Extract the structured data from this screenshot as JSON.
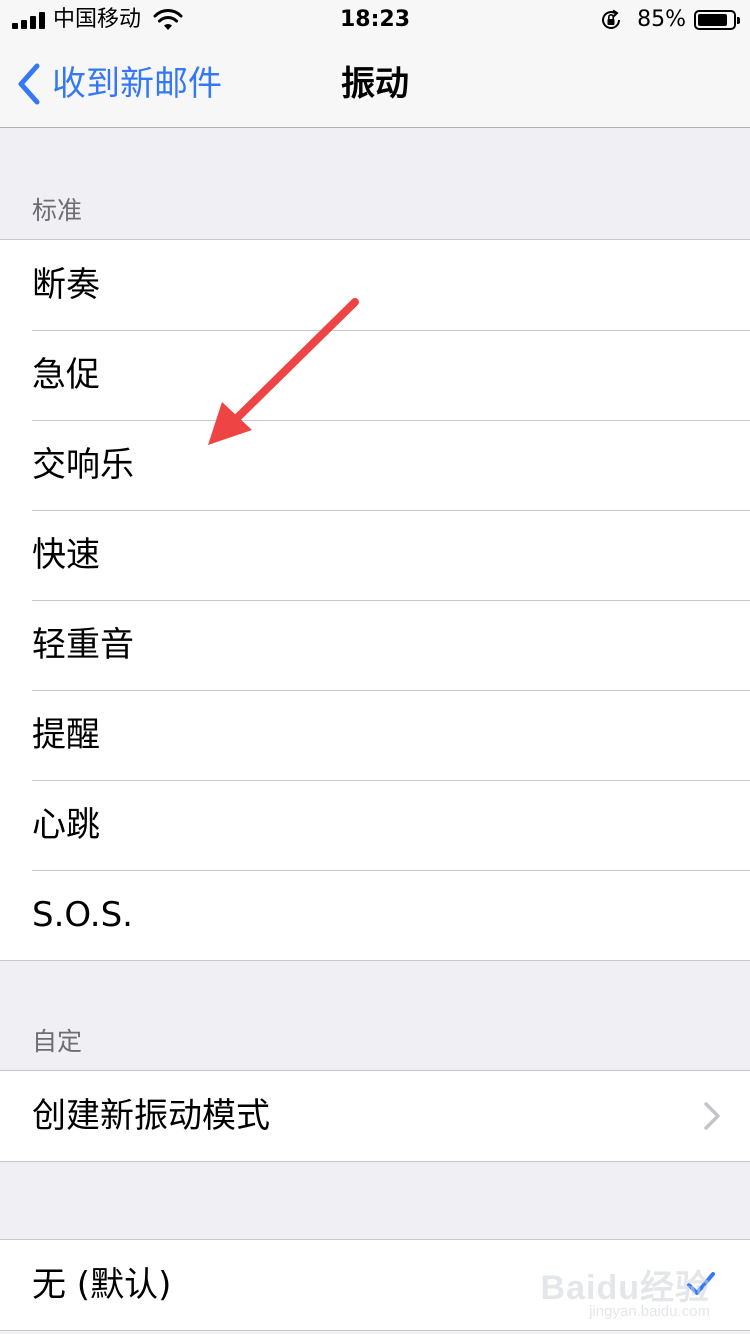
{
  "status_bar": {
    "carrier": "中国移动",
    "time": "18:23",
    "battery_percent": "85%",
    "battery_level": 0.85,
    "icons": [
      "signal-icon",
      "wifi-icon",
      "rotation-lock-icon",
      "battery-icon"
    ]
  },
  "nav": {
    "back_label": "收到新邮件",
    "title": "振动",
    "accent_color": "#3478f6"
  },
  "standard_section": {
    "header": "标准",
    "items": [
      {
        "label": "断奏"
      },
      {
        "label": "急促"
      },
      {
        "label": "交响乐"
      },
      {
        "label": "快速"
      },
      {
        "label": "轻重音"
      },
      {
        "label": "提醒"
      },
      {
        "label": "心跳"
      },
      {
        "label": "S.O.S."
      }
    ]
  },
  "custom_section": {
    "header": "自定",
    "create_label": "创建新振动模式"
  },
  "none_section": {
    "none_label": "无 (默认)",
    "selected": true
  },
  "annotation": {
    "arrow_color": "#ef4444"
  },
  "watermark": {
    "text": "Baidu经验",
    "subtext": "jingyan.baidu.com"
  }
}
